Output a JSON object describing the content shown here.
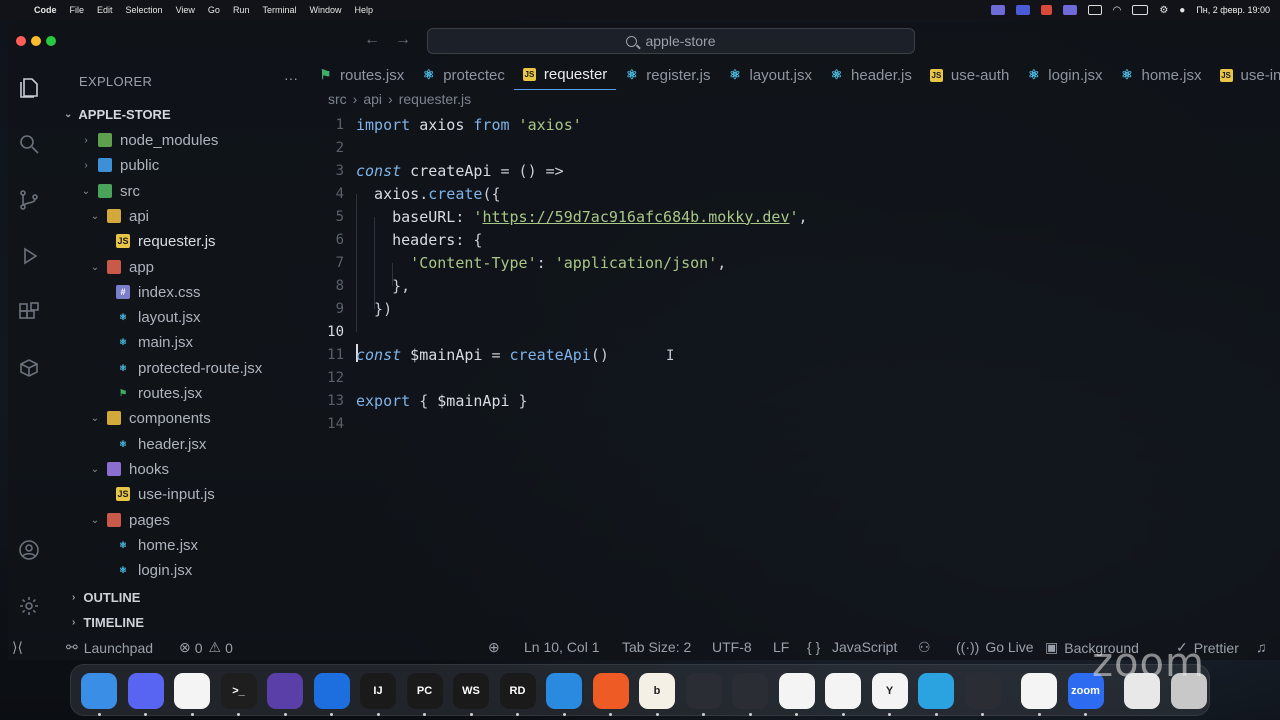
{
  "menubar": {
    "app_name": "Code",
    "items": [
      "File",
      "Edit",
      "Selection",
      "View",
      "Go",
      "Run",
      "Terminal",
      "Window",
      "Help"
    ],
    "clock": "Пн, 2 февр. 19:00"
  },
  "window": {
    "search_text": "apple-store"
  },
  "explorer": {
    "title": "EXPLORER",
    "more": "···",
    "root": "APPLE-STORE",
    "tree": [
      {
        "label": "node_modules",
        "depth": 1,
        "expanded": false,
        "icon": "folder-node-icon"
      },
      {
        "label": "public",
        "depth": 1,
        "expanded": false,
        "icon": "folder-public-icon"
      },
      {
        "label": "src",
        "depth": 1,
        "expanded": true,
        "icon": "folder-src-icon"
      },
      {
        "label": "api",
        "depth": 2,
        "expanded": true,
        "icon": "folder-api-icon"
      },
      {
        "label": "requester.js",
        "depth": 3,
        "icon": "js-file-icon",
        "selected": true
      },
      {
        "label": "app",
        "depth": 2,
        "expanded": true,
        "icon": "folder-app-icon"
      },
      {
        "label": "index.css",
        "depth": 3,
        "icon": "css-file-icon"
      },
      {
        "label": "layout.jsx",
        "depth": 3,
        "icon": "react-file-icon"
      },
      {
        "label": "main.jsx",
        "depth": 3,
        "icon": "react-file-icon"
      },
      {
        "label": "protected-route.jsx",
        "depth": 3,
        "icon": "react-file-icon"
      },
      {
        "label": "routes.jsx",
        "depth": 3,
        "icon": "routes-file-icon"
      },
      {
        "label": "components",
        "depth": 2,
        "expanded": true,
        "icon": "folder-components-icon"
      },
      {
        "label": "header.jsx",
        "depth": 3,
        "icon": "react-file-icon"
      },
      {
        "label": "hooks",
        "depth": 2,
        "expanded": true,
        "icon": "folder-hooks-icon"
      },
      {
        "label": "use-input.js",
        "depth": 3,
        "icon": "js-file-icon"
      },
      {
        "label": "pages",
        "depth": 2,
        "expanded": true,
        "icon": "folder-pages-icon"
      },
      {
        "label": "home.jsx",
        "depth": 3,
        "icon": "react-file-icon"
      },
      {
        "label": "login.jsx",
        "depth": 3,
        "icon": "react-file-icon"
      }
    ],
    "outline": "OUTLINE",
    "timeline": "TIMELINE"
  },
  "tabs": [
    {
      "label": "routes.jsx",
      "icon": "route",
      "active": false
    },
    {
      "label": "protectec",
      "icon": "react",
      "active": false
    },
    {
      "label": "requester",
      "icon": "js",
      "active": true
    },
    {
      "label": "register.js",
      "icon": "react",
      "active": false
    },
    {
      "label": "layout.jsx",
      "icon": "react",
      "active": false
    },
    {
      "label": "header.js",
      "icon": "react",
      "active": false
    },
    {
      "label": "use-auth",
      "icon": "js",
      "active": false
    },
    {
      "label": "login.jsx",
      "icon": "react",
      "active": false
    },
    {
      "label": "home.jsx",
      "icon": "react",
      "active": false
    },
    {
      "label": "use-inpu",
      "icon": "js",
      "active": false
    }
  ],
  "breadcrumb": [
    "src",
    "api",
    "requester.js"
  ],
  "editor": {
    "current_line": 10,
    "lines": [
      {
        "n": "1",
        "tokens": [
          [
            "kw",
            "import"
          ],
          [
            "var",
            " axios "
          ],
          [
            "kw",
            "from"
          ],
          [
            "str",
            " 'axios'"
          ]
        ]
      },
      {
        "n": "2",
        "tokens": []
      },
      {
        "n": "3",
        "tokens": [
          [
            "kwi",
            "const"
          ],
          [
            "var",
            " createApi "
          ],
          [
            "punct",
            "= () =>"
          ]
        ]
      },
      {
        "n": "4",
        "tokens": [
          [
            "var",
            "  axios"
          ],
          [
            "punct",
            "."
          ],
          [
            "fn",
            "create"
          ],
          [
            "punct",
            "({"
          ]
        ]
      },
      {
        "n": "5",
        "tokens": [
          [
            "var",
            "    baseURL"
          ],
          [
            "punct",
            ": "
          ],
          [
            "str",
            "'"
          ],
          [
            "url",
            "https://59d7ac916afc684b.mokky.dev"
          ],
          [
            "str",
            "'"
          ],
          [
            "punct",
            ","
          ]
        ]
      },
      {
        "n": "6",
        "tokens": [
          [
            "var",
            "    headers"
          ],
          [
            "punct",
            ": {"
          ]
        ]
      },
      {
        "n": "7",
        "tokens": [
          [
            "str",
            "      'Content-Type'"
          ],
          [
            "punct",
            ": "
          ],
          [
            "str",
            "'application/json'"
          ],
          [
            "punct",
            ","
          ]
        ]
      },
      {
        "n": "8",
        "tokens": [
          [
            "punct",
            "    },"
          ]
        ]
      },
      {
        "n": "9",
        "tokens": [
          [
            "punct",
            "  })"
          ]
        ]
      },
      {
        "n": "10",
        "tokens": []
      },
      {
        "n": "11",
        "tokens": [
          [
            "kwi",
            "const"
          ],
          [
            "var",
            " $mainApi "
          ],
          [
            "punct",
            "= "
          ],
          [
            "fn",
            "createApi"
          ],
          [
            "punct",
            "()"
          ]
        ]
      },
      {
        "n": "12",
        "tokens": []
      },
      {
        "n": "13",
        "tokens": [
          [
            "kw",
            "export"
          ],
          [
            "punct",
            " { "
          ],
          [
            "var",
            "$mainApi"
          ],
          [
            "punct",
            " }"
          ]
        ]
      },
      {
        "n": "14",
        "tokens": []
      }
    ]
  },
  "statusbar": {
    "remote": "",
    "launchpad": "Launchpad",
    "errors": "0",
    "warnings": "0",
    "position": "Ln 10, Col 1",
    "tab_size": "Tab Size: 2",
    "encoding": "UTF-8",
    "eol": "LF",
    "language_braces": "{ }",
    "language": "JavaScript",
    "go_live": "Go Live",
    "background": "Background",
    "prettier": "Prettier"
  },
  "dock": {
    "apps": [
      {
        "name": "finder-app",
        "label": "",
        "color": "#3a8ee6"
      },
      {
        "name": "discord-app",
        "label": "",
        "color": "#5865f2"
      },
      {
        "name": "slack-app",
        "label": "",
        "color": "#f4f4f4"
      },
      {
        "name": "terminal-app",
        "label": ">_",
        "color": "#1e1e1e"
      },
      {
        "name": "obsidian-app",
        "label": "",
        "color": "#5b3fa8"
      },
      {
        "name": "xcode-app",
        "label": "",
        "color": "#1d6fe0"
      },
      {
        "name": "intellij-app",
        "label": "IJ",
        "color": "#1a1a1a"
      },
      {
        "name": "pycharm-app",
        "label": "PC",
        "color": "#1a1a1a"
      },
      {
        "name": "webstorm-app",
        "label": "WS",
        "color": "#1a1a1a"
      },
      {
        "name": "rider-app",
        "label": "RD",
        "color": "#1a1a1a"
      },
      {
        "name": "docker-app",
        "label": "",
        "color": "#2a8ae0"
      },
      {
        "name": "postman-app",
        "label": "",
        "color": "#ef5b25"
      },
      {
        "name": "bitwarden-app",
        "label": "b",
        "color": "#f5f0e6"
      },
      {
        "name": "arc-app",
        "label": "",
        "color": "#2a2d33"
      },
      {
        "name": "box-app",
        "label": "",
        "color": "#2a2d33"
      },
      {
        "name": "vscode-app",
        "label": "",
        "color": "#f4f4f4"
      },
      {
        "name": "chrome-app",
        "label": "",
        "color": "#f4f4f4"
      },
      {
        "name": "yandex-app",
        "label": "Y",
        "color": "#f4f4f4"
      },
      {
        "name": "telegram-app",
        "label": "",
        "color": "#2aa3e0"
      },
      {
        "name": "obs-app",
        "label": "",
        "color": "#2a2d33"
      },
      {
        "name": "chrome2-app",
        "label": "",
        "color": "#f4f4f4"
      },
      {
        "name": "zoom-app",
        "label": "zoom",
        "color": "#2d6cf0"
      },
      {
        "name": "preview-app",
        "label": "",
        "color": "#e8e8e8"
      },
      {
        "name": "trash-app",
        "label": "",
        "color": "#c8c8c8"
      }
    ]
  },
  "watermark": "zoom"
}
